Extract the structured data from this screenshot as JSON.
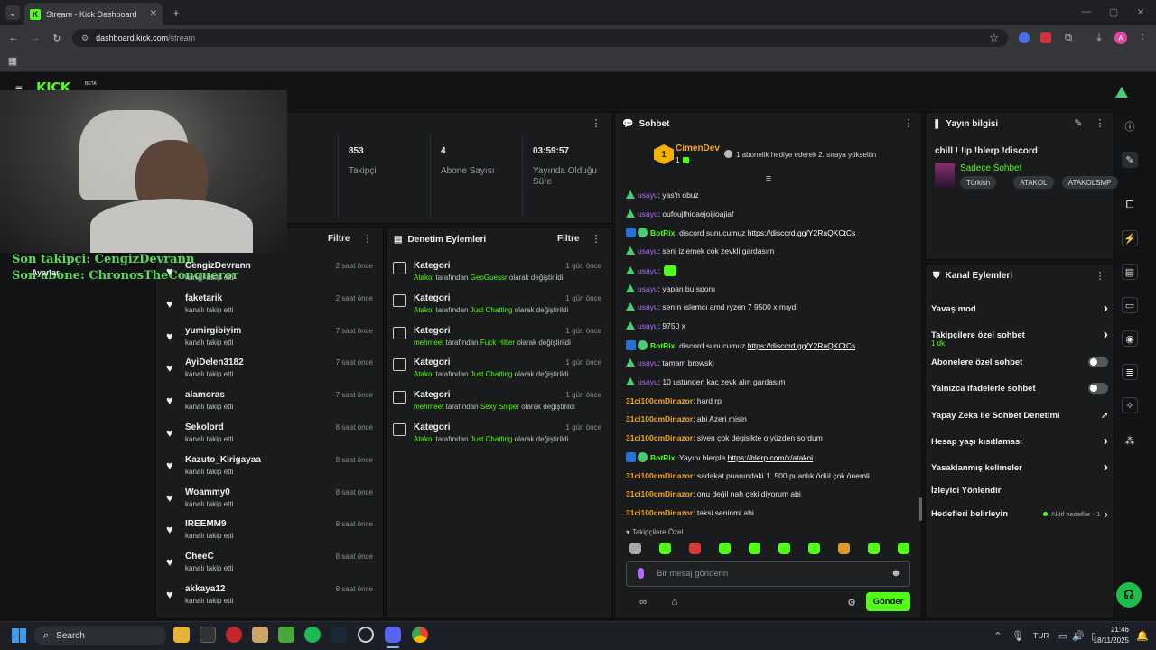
{
  "browser": {
    "tab_title": "Stream - Kick Dashboard",
    "tab_close": "✕",
    "new_tab": "+",
    "url_prefix": "dashboard.kick.com",
    "url_path": "/stream",
    "window_controls": [
      "—",
      "▢",
      "✕"
    ]
  },
  "overlay": {
    "last_follower": "Son takipçi: CengizDevrann",
    "last_sub": "Son abone: ChronosTheConqueror",
    "logo": "KICK",
    "logo_badge": "BETA"
  },
  "stats": {
    "followers_value": "853",
    "followers_label": "Takipçi",
    "subs_value": "4",
    "subs_label": "Abone Sayısı",
    "uptime_value": "03:59:57",
    "uptime_label": "Yayında Olduğu Süre"
  },
  "settings_label": "Ayarlar",
  "activity": {
    "filter_label": "Filtre",
    "items": [
      {
        "name": "CengizDevrann",
        "sub": "kanalı takip etti",
        "time": "2 saat önce"
      },
      {
        "name": "faketarik",
        "sub": "kanalı takip etti",
        "time": "2 saat önce"
      },
      {
        "name": "yumirgibiyim",
        "sub": "kanalı takip etti",
        "time": "7 saat önce"
      },
      {
        "name": "AyiDelen3182",
        "sub": "kanalı takip etti",
        "time": "7 saat önce"
      },
      {
        "name": "alamoras",
        "sub": "kanalı takip etti",
        "time": "7 saat önce"
      },
      {
        "name": "Sekolord",
        "sub": "kanalı takip etti",
        "time": "8 saat önce"
      },
      {
        "name": "Kazuto_Kirigayaa",
        "sub": "kanalı takip etti",
        "time": "8 saat önce"
      },
      {
        "name": "Woammy0",
        "sub": "kanalı takip etti",
        "time": "8 saat önce"
      },
      {
        "name": "IREEMM9",
        "sub": "kanalı takip etti",
        "time": "8 saat önce"
      },
      {
        "name": "CheeC",
        "sub": "kanalı takip etti",
        "time": "8 saat önce"
      },
      {
        "name": "akkaya12",
        "sub": "kanalı takip etti",
        "time": "8 saat önce"
      }
    ]
  },
  "moderation": {
    "title": "Denetim Eylemleri",
    "filter_label": "Filtre",
    "items": [
      {
        "title": "Kategori",
        "who": "Atakoi",
        "mid": "tarafından",
        "what": "GeoGuessr",
        "end": "olarak değiştirildi",
        "time": "1 gün önce"
      },
      {
        "title": "Kategori",
        "who": "Atakoi",
        "mid": "tarafından",
        "what": "Just Chatting",
        "end": "olarak değiştirildi",
        "time": "1 gün önce"
      },
      {
        "title": "Kategori",
        "who": "mehmeet",
        "mid": "tarafından",
        "what": "Fuck Hitler",
        "end": "olarak değiştirildi",
        "time": "1 gün önce"
      },
      {
        "title": "Kategori",
        "who": "Atakoi",
        "mid": "tarafından",
        "what": "Just Chatting",
        "end": "olarak değiştirildi",
        "time": "1 gün önce"
      },
      {
        "title": "Kategori",
        "who": "mehmeet",
        "mid": "tarafından",
        "what": "Sexy Sniper",
        "end": "olarak değiştirildi",
        "time": "1 gün önce"
      },
      {
        "title": "Kategori",
        "who": "Atakoi",
        "mid": "tarafından",
        "what": "Just Chatting",
        "end": "olarak değiştirildi",
        "time": "1 gün önce"
      }
    ]
  },
  "chat": {
    "title": "Sohbet",
    "pinned_user": "CimenDev",
    "pinned_rank": "1",
    "pinned_count": "1",
    "pinned_text": "1 abonelik hediye ederek 2. sıraya yükseltin",
    "messages": [
      {
        "user": "usayu",
        "text": ": yas'n obuz"
      },
      {
        "user": "usayu",
        "text": ": oufoujfhioaejoijioajiaf"
      },
      {
        "user": "BotRix",
        "bot": true,
        "text": ": discord sunucumuz ",
        "link": "https://discord.gg/Y2RaQKCtCs"
      },
      {
        "user": "usayu",
        "text": ": seni izlemek cok zevkli gardasım"
      },
      {
        "user": "usayu",
        "text": ":",
        "emote": true
      },
      {
        "user": "usayu",
        "text": ": yapan bu sporu"
      },
      {
        "user": "usayu",
        "text": ": senın ıslemcı amd ryzen 7 9500 x mıydı"
      },
      {
        "user": "usayu",
        "text": ": 9750 x"
      },
      {
        "user": "BotRix",
        "bot": true,
        "text": ": discord sunucumuz ",
        "link": "https://discord.gg/Y2RaQKCtCs"
      },
      {
        "user": "usayu",
        "text": ": tamam browskı"
      },
      {
        "user": "usayu",
        "text": ": 10 ustunden kac zevk alın gardasım"
      },
      {
        "user": "31ci100cmDinazor",
        "text": ": hard rp"
      },
      {
        "user": "31ci100cmDinazor",
        "text": ": abi Azeri misin"
      },
      {
        "user": "31ci100cmDinazor",
        "text": ": siven çok degisikte o yüzden sordum"
      },
      {
        "user": "BotRix",
        "bot": true,
        "text": ": Yayını blerple ",
        "link": "https://blerp.com/x/atakoi"
      },
      {
        "user": "31ci100cmDinazor",
        "text": ": sadakat puanındaki 1. 500 puanlık ödül çok önemli"
      },
      {
        "user": "31ci100cmDinazor",
        "text": ": onu değil nah çeki diyorum abi"
      },
      {
        "user": "31ci100cmDinazor",
        "text": ": taksi seninmi abi"
      }
    ],
    "followers_only": "Takipçilere Özel",
    "input_placeholder": "Bir mesaj gönderin",
    "send_label": "Gönder"
  },
  "stream_info": {
    "title": "Yayın bilgisi",
    "stream_title": "chill ! !ip !blerp !discord",
    "category": "Sadece Sohbet",
    "tags": [
      "Türkish",
      "ATAKOL",
      "ATAKOLSMP"
    ]
  },
  "channel_actions": {
    "title": "Kanal Eylemleri",
    "items": [
      {
        "label": "Yavaş mod",
        "kind": "arrow"
      },
      {
        "label": "Takipçilere özel sohbet",
        "sub": "1 dk.",
        "kind": "arrow"
      },
      {
        "label": "Abonelere özel sohbet",
        "kind": "toggle"
      },
      {
        "label": "Yalnızca ifadelerle sohbet",
        "kind": "toggle"
      },
      {
        "label": "Yapay Zeka ile Sohbet Denetimi",
        "kind": "ext"
      },
      {
        "label": "Hesap yaşı kısıtlaması",
        "kind": "arrow"
      },
      {
        "label": "Yasaklanmış kelimeler",
        "kind": "arrow"
      },
      {
        "label": "İzleyici Yönlendir",
        "kind": "none"
      },
      {
        "label": "Hedefleri belirleyin",
        "kind": "goal",
        "extra": "Aktif hedefler - 1"
      }
    ]
  },
  "taskbar": {
    "search": "Search",
    "lang": "TUR",
    "time": "21:46",
    "date": "18/11/2025"
  }
}
